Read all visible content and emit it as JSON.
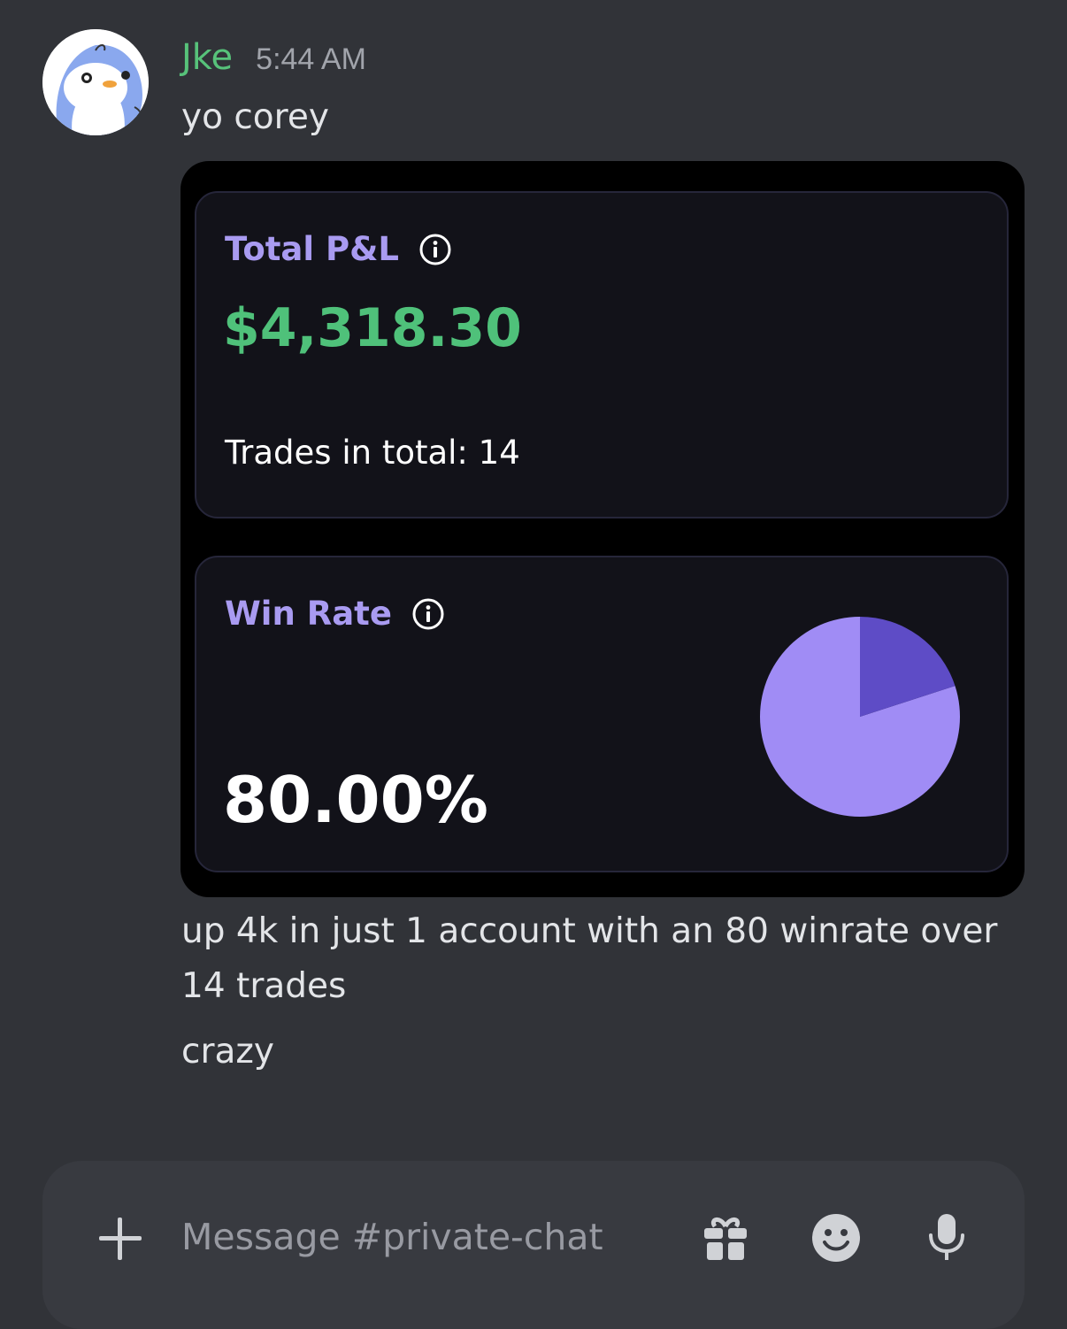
{
  "message": {
    "username": "Jke",
    "timestamp": "5:44 AM",
    "lines": [
      "yo corey",
      "up 4k in just 1 account with an 80 winrate over",
      "14 trades",
      "crazy"
    ]
  },
  "attachment": {
    "pnl_card": {
      "label": "Total P&L",
      "value": "$4,318.30",
      "trades_text": "Trades in total: 14"
    },
    "winrate_card": {
      "label": "Win Rate",
      "value": "80.00%",
      "win_fraction": 0.8
    }
  },
  "composer": {
    "placeholder": "Message #private-chat"
  },
  "colors": {
    "username": "#57c27a",
    "pnl_value": "#4fc17a",
    "card_label": "#a99bf1",
    "pie_win": "#a08cf5",
    "pie_loss": "#5e4cc6"
  },
  "icons": [
    "avatar-penguin-icon",
    "info-icon",
    "plus-icon",
    "gift-icon",
    "emoji-icon",
    "microphone-icon"
  ]
}
